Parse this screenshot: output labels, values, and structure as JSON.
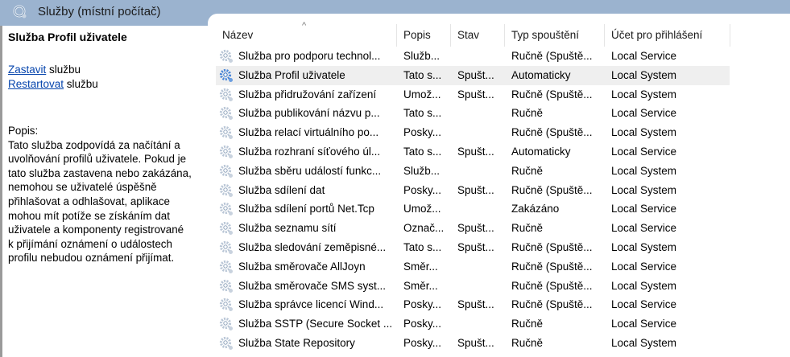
{
  "window": {
    "title": "Služby (místní počítač)"
  },
  "left_panel": {
    "service_title": "Služba Profil uživatele",
    "actions": [
      {
        "link": "Zastavit",
        "rest": " službu"
      },
      {
        "link": "Restartovat",
        "rest": " službu"
      }
    ],
    "desc_label": "Popis:",
    "desc_lines": [
      "Tato služba zodpovídá za načítání a",
      "uvolňování profilů uživatele. Pokud je",
      "tato služba zastavena nebo zakázána,",
      "nemohou se uživatelé úspěšně",
      "přihlašovat a odhlašovat, aplikace",
      "mohou mít potíže se získáním dat",
      "uživatele a komponenty registrované",
      "k přijímání oznámení o událostech",
      "profilu nebudou oznámení přijímat."
    ]
  },
  "table": {
    "columns": [
      "Název",
      "Popis",
      "Stav",
      "Typ spouštění",
      "Účet pro přihlášení"
    ],
    "sort_indicator": "^",
    "rows": [
      [
        "Služba pro podporu technol...",
        "Služb...",
        "",
        "Ručně (Spuště...",
        "Local Service"
      ],
      [
        "Služba Profil uživatele",
        "Tato s...",
        "Spušt...",
        "Automaticky",
        "Local System"
      ],
      [
        "Služba přidružování zařízení",
        "Umož...",
        "Spušt...",
        "Ručně (Spuště...",
        "Local System"
      ],
      [
        "Služba publikování názvu p...",
        "Tato s...",
        "",
        "Ručně",
        "Local Service"
      ],
      [
        "Služba relací virtuálního po...",
        "Posky...",
        "",
        "Ručně (Spuště...",
        "Local System"
      ],
      [
        "Služba rozhraní síťového úl...",
        "Tato s...",
        "Spušt...",
        "Automaticky",
        "Local Service"
      ],
      [
        "Služba sběru událostí funkc...",
        "Služb...",
        "",
        "Ručně",
        "Local System"
      ],
      [
        "Služba sdílení dat",
        "Posky...",
        "Spušt...",
        "Ručně (Spuště...",
        "Local System"
      ],
      [
        "Služba sdílení portů Net.Tcp",
        "Umož...",
        "",
        "Zakázáno",
        "Local Service"
      ],
      [
        "Služba seznamu sítí",
        "Označ...",
        "Spušt...",
        "Ručně",
        "Local Service"
      ],
      [
        "Služba sledování zeměpisné...",
        "Tato s...",
        "Spušt...",
        "Ručně (Spuště...",
        "Local System"
      ],
      [
        "Služba směrovače AllJoyn",
        "Směr...",
        "",
        "Ručně (Spuště...",
        "Local Service"
      ],
      [
        "Služba směrovače SMS syst...",
        "Směr...",
        "",
        "Ručně (Spuště...",
        "Local System"
      ],
      [
        "Služba správce licencí Wind...",
        "Posky...",
        "Spušt...",
        "Ručně (Spuště...",
        "Local Service"
      ],
      [
        "Služba SSTP (Secure Socket ...",
        "Posky...",
        "",
        "Ručně",
        "Local Service"
      ],
      [
        "Služba State Repository",
        "Posky...",
        "Spušt...",
        "Ručně",
        "Local System"
      ]
    ],
    "selected_row": 1
  }
}
